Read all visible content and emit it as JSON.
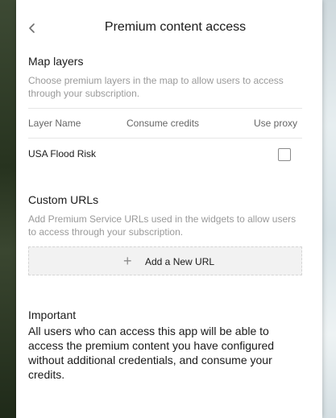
{
  "header": {
    "title": "Premium content access"
  },
  "map_layers": {
    "title": "Map layers",
    "description": "Choose premium layers in the map to allow users to access through your subscription.",
    "columns": [
      "Layer Name",
      "Consume credits",
      "Use proxy"
    ],
    "rows": [
      {
        "name": "USA Flood Risk",
        "use_proxy": false
      }
    ]
  },
  "custom_urls": {
    "title": "Custom URLs",
    "description": "Add Premium Service URLs used in the widgets to allow users to access through your subscription.",
    "add_button_label": "Add a New URL"
  },
  "important": {
    "title": "Important",
    "text": "All users who can access this app will be able to access the premium content you have configured without additional credentials, and consume your credits."
  }
}
